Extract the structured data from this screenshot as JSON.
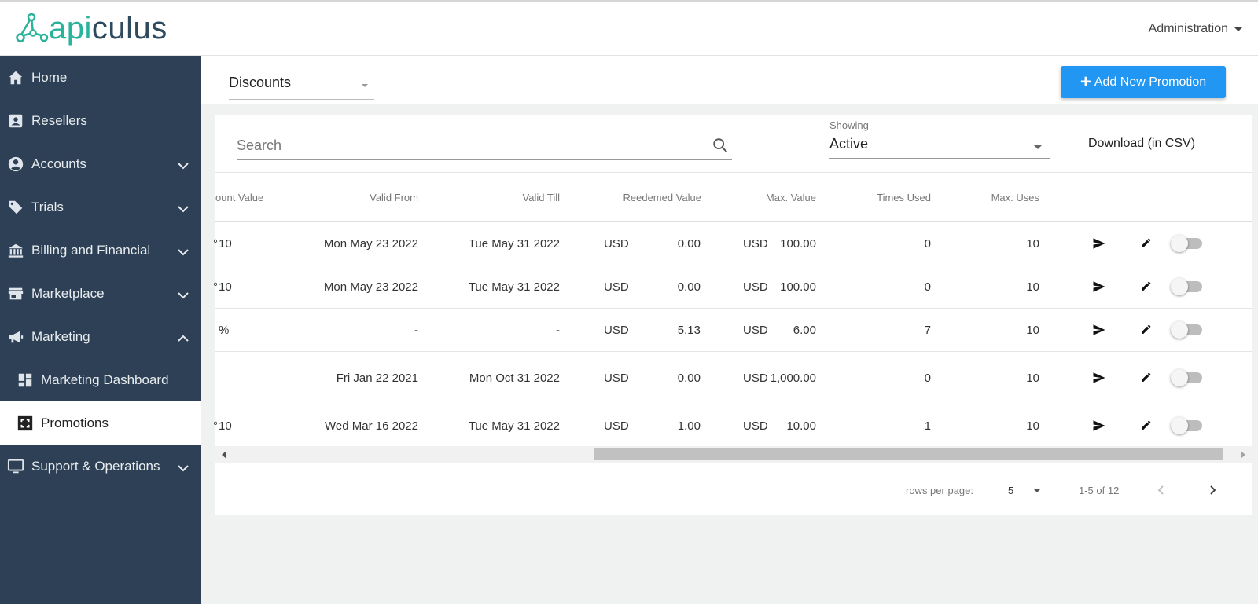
{
  "header": {
    "logo_part1": "api",
    "logo_part2": "culus",
    "admin_label": "Administration"
  },
  "sidebar": {
    "items": [
      {
        "label": "Home",
        "icon": "home-icon"
      },
      {
        "label": "Resellers",
        "icon": "contact-card-icon"
      },
      {
        "label": "Accounts",
        "icon": "account-circle-icon",
        "expandable": true
      },
      {
        "label": "Trials",
        "icon": "tag-icon",
        "expandable": true
      },
      {
        "label": "Billing and Financial",
        "icon": "bank-icon",
        "expandable": true
      },
      {
        "label": "Marketplace",
        "icon": "store-icon",
        "expandable": true
      },
      {
        "label": "Marketing",
        "icon": "megaphone-icon",
        "expandable": true,
        "expanded": true
      },
      {
        "label": "Marketing Dashboard",
        "icon": "dashboard-icon",
        "sub": true
      },
      {
        "label": "Promotions",
        "icon": "promotions-icon",
        "sub": true,
        "active": true
      },
      {
        "label": "Support & Operations",
        "icon": "monitor-icon",
        "expandable": true
      }
    ]
  },
  "toolbar": {
    "type_value": "Discounts",
    "add_button_label": "Add New Promotion"
  },
  "filters": {
    "search_placeholder": "Search",
    "showing_label": "Showing",
    "showing_value": "Active",
    "download_label": "Download (in CSV)"
  },
  "table": {
    "columns": [
      "ount Value",
      "Valid From",
      "Valid Till",
      "Reedemed Value",
      "Max. Value",
      "Times Used",
      "Max. Uses"
    ],
    "rows": [
      {
        "discount": "10",
        "prefix": true,
        "valid_from": "Mon May 23 2022",
        "valid_till": "Tue May 31 2022",
        "red_cur": "USD",
        "red_val": "0.00",
        "max_cur": "USD",
        "max_val": "100.00",
        "times_used": "0",
        "max_uses": "10"
      },
      {
        "discount": "10",
        "prefix": true,
        "valid_from": "Mon May 23 2022",
        "valid_till": "Tue May 31 2022",
        "red_cur": "USD",
        "red_val": "0.00",
        "max_cur": "USD",
        "max_val": "100.00",
        "times_used": "0",
        "max_uses": "10"
      },
      {
        "discount": "%",
        "prefix": false,
        "valid_from": "-",
        "valid_till": "-",
        "red_cur": "USD",
        "red_val": "5.13",
        "max_cur": "USD",
        "max_val": "6.00",
        "times_used": "7",
        "max_uses": "10"
      },
      {
        "discount": "",
        "prefix": false,
        "valid_from": "Fri Jan 22 2021",
        "valid_till": "Mon Oct 31 2022",
        "red_cur": "USD",
        "red_val": "0.00",
        "max_cur": "USD",
        "max_val": "1,000.00",
        "times_used": "0",
        "max_uses": "10"
      },
      {
        "discount": "10",
        "prefix": true,
        "valid_from": "Wed Mar 16 2022",
        "valid_till": "Tue May 31 2022",
        "red_cur": "USD",
        "red_val": "1.00",
        "max_cur": "USD",
        "max_val": "10.00",
        "times_used": "1",
        "max_uses": "10"
      }
    ]
  },
  "pagination": {
    "rows_per_page_label": "rows per page:",
    "rows_per_page_value": "5",
    "range_text": "1-5 of 12"
  },
  "colors": {
    "sidebar_bg": "#2d4055",
    "accent": "#2196f3",
    "logo_green": "#2ab39b",
    "logo_navy": "#2d4a5f"
  }
}
